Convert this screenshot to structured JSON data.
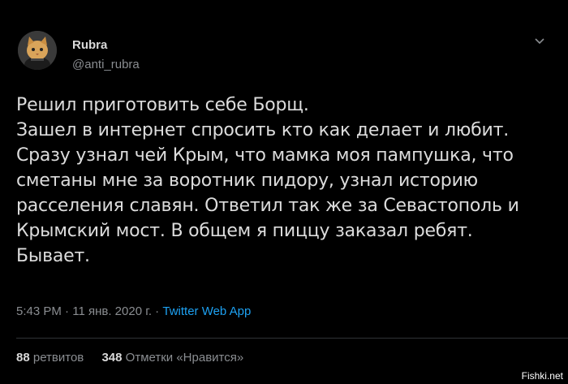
{
  "tweet": {
    "author_name": "Rubra",
    "author_handle": "@anti_rubra",
    "text": "Решил приготовить себе Борщ.\nЗашел в интернет спросить кто как делает и любит.\nСразу узнал чей Крым, что мамка моя пампушка, что\nсметаны мне за воротник пидору, узнал историю\nрасселения славян. Ответил так же за Севастополь и\nКрымский мост. В общем я пиццу заказал ребят.\nБывает.",
    "time": "5:43 PM",
    "separator": " · ",
    "date": "11 янв. 2020 г.",
    "app": "Twitter Web App",
    "retweets_count": "88",
    "retweets_label": "ретвитов",
    "likes_count": "348",
    "likes_label": "Отметки «Нравится»"
  },
  "watermark": "Fishki.net",
  "colors": {
    "background": "#000000",
    "link": "#1da1f2",
    "muted": "#8a8d91"
  }
}
